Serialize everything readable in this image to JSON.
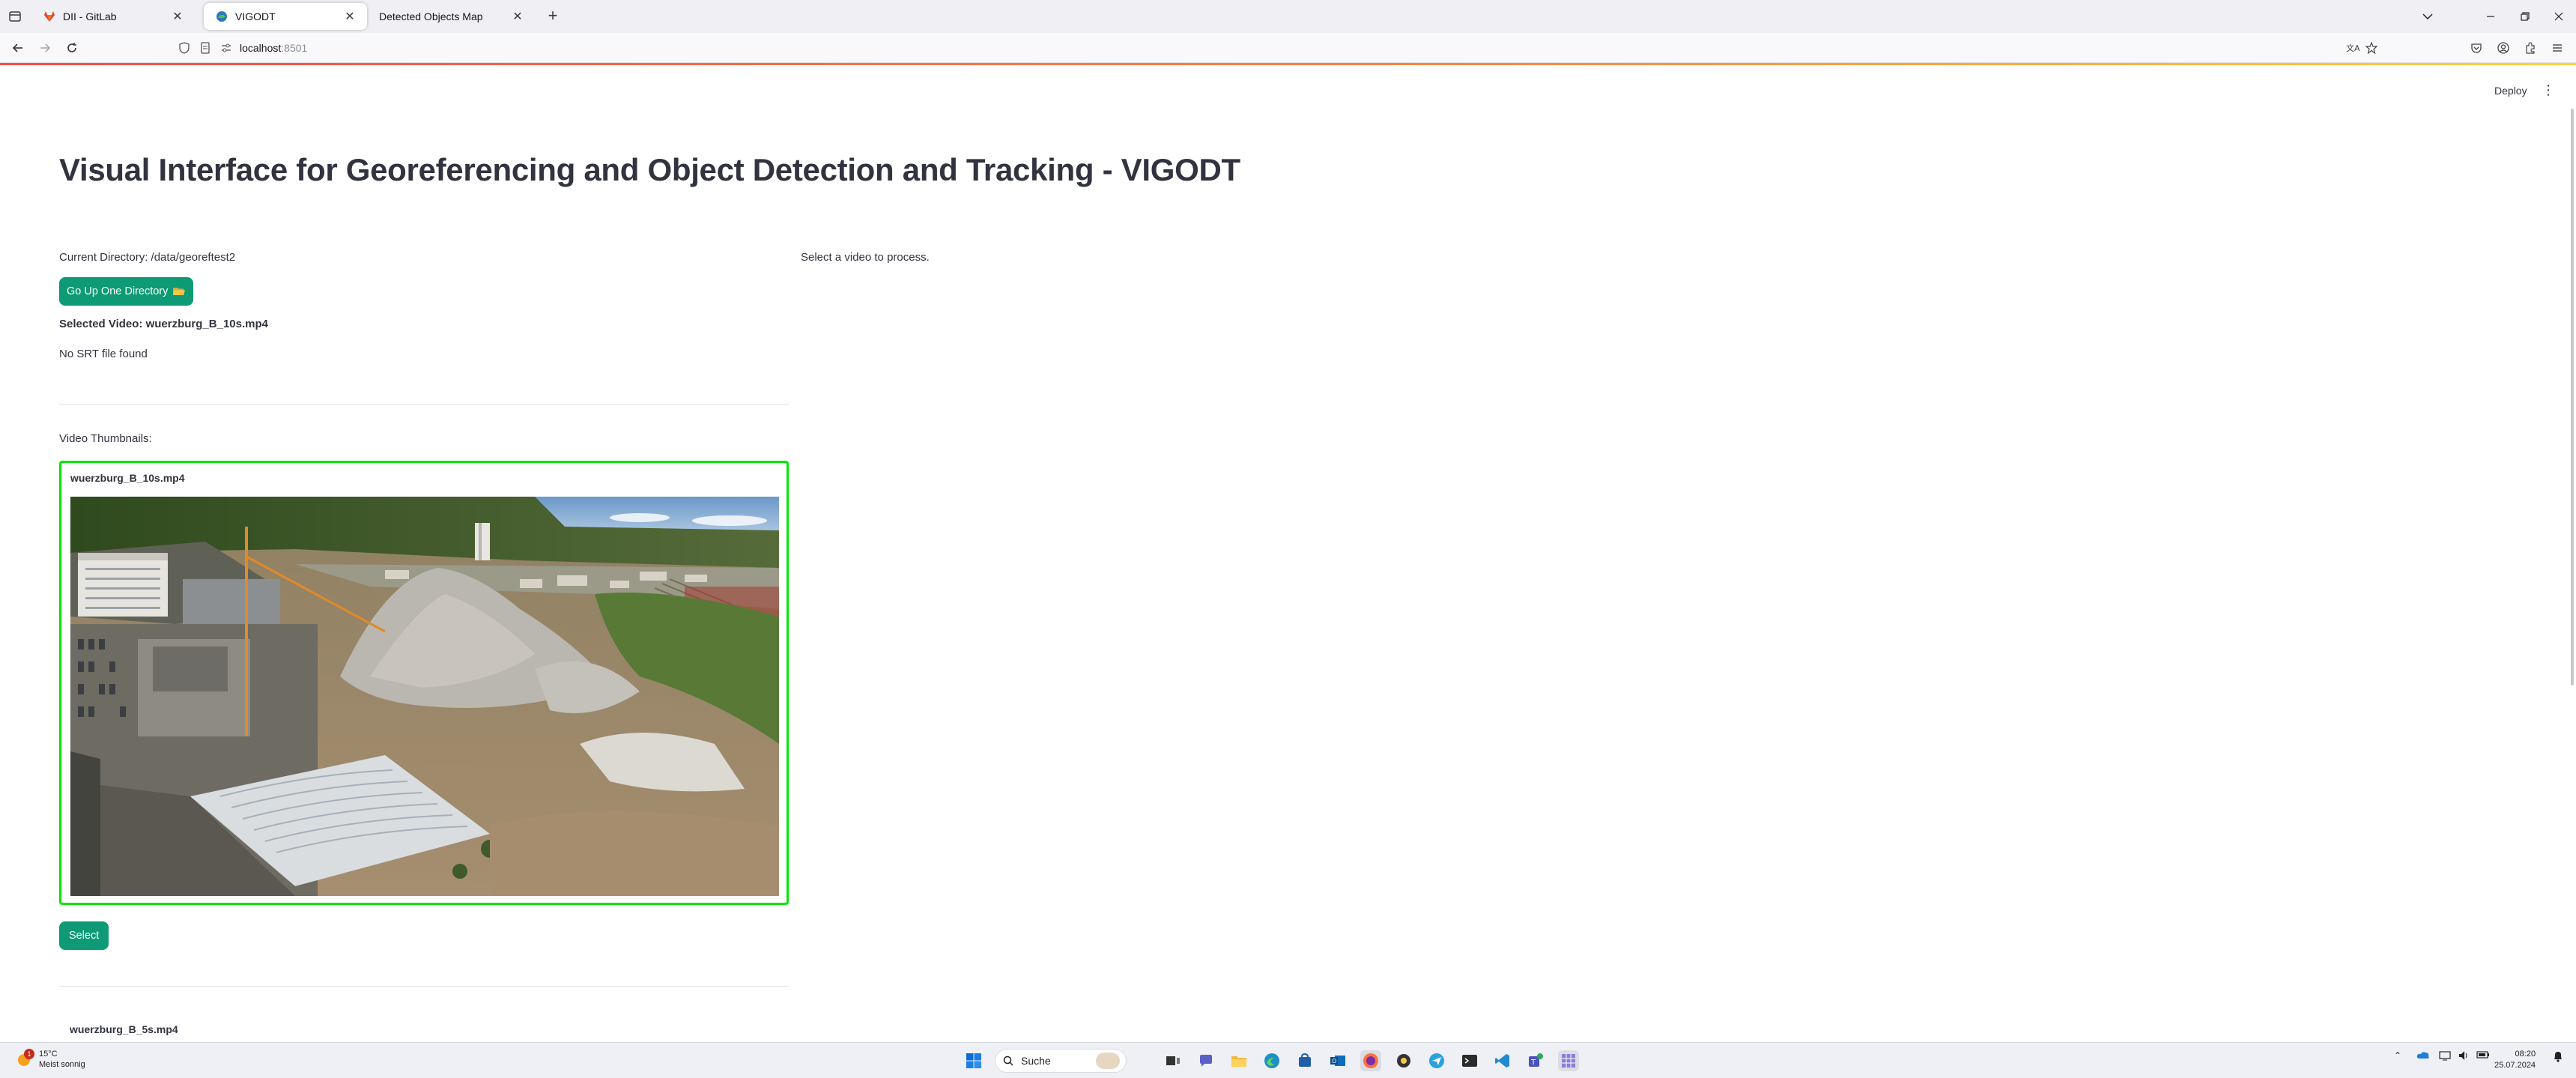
{
  "browser": {
    "tabs": [
      {
        "title": "DII - GitLab",
        "active": false,
        "favicon": "gitlab-icon"
      },
      {
        "title": "VIGODT",
        "active": true,
        "favicon": "streamlit-icon"
      },
      {
        "title": "Detected Objects Map",
        "active": false,
        "favicon": ""
      }
    ],
    "url_host": "localhost",
    "url_port": ":8501"
  },
  "app": {
    "header": {
      "deploy_label": "Deploy"
    },
    "title": "Visual Interface for Georeferencing and Object Detection and Tracking - VIGODT",
    "current_directory": "Current Directory: /data/georeftest2",
    "go_up_label": "Go Up One Directory",
    "selected_video": "Selected Video: wuerzburg_B_10s.mp4",
    "srt_status": "No SRT file found",
    "thumbnails_label": "Video Thumbnails:",
    "videos": [
      {
        "name": "wuerzburg_B_10s.mp4",
        "select_label": "Select",
        "selected": true
      },
      {
        "name": "wuerzburg_B_5s.mp4"
      }
    ],
    "right_message": "Select a video to process."
  },
  "taskbar": {
    "weather_temp": "15°C",
    "weather_desc": "Meist sonnig",
    "weather_badge": "1",
    "search_label": "Suche",
    "time": "08:20",
    "date": "25.07.2024"
  },
  "colors": {
    "accent_green": "#0d9a74",
    "selection_border": "#00e600",
    "text": "#31333f"
  }
}
